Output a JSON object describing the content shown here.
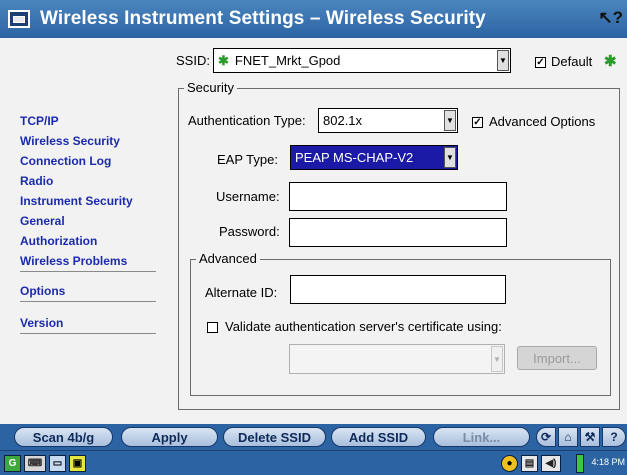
{
  "window": {
    "title": "Wireless Instrument Settings – Wireless Security",
    "help_icon": "help-cursor-icon",
    "help_glyph": "↖?"
  },
  "sidebar": {
    "items": [
      {
        "label": "TCP/IP"
      },
      {
        "label": "Wireless Security",
        "selected": true
      },
      {
        "label": "Connection Log"
      },
      {
        "label": "Radio"
      },
      {
        "label": "Instrument Security"
      },
      {
        "label": "General"
      },
      {
        "label": "Authorization"
      },
      {
        "label": "Wireless Problems"
      },
      {
        "label": "Options"
      },
      {
        "label": "Version"
      }
    ]
  },
  "ssid": {
    "label": "SSID:",
    "value": "FNET_Mrkt_Gpod",
    "icon": "network-star-icon",
    "default_label": "Default",
    "default_checked": true
  },
  "security": {
    "legend": "Security",
    "auth_type_label": "Authentication Type:",
    "auth_type_value": "802.1x",
    "advanced_options_label": "Advanced Options",
    "advanced_options_checked": true,
    "eap_type_label": "EAP Type:",
    "eap_type_value": "PEAP MS-CHAP-V2",
    "username_label": "Username:",
    "username_value": "",
    "password_label": "Password:",
    "password_value": ""
  },
  "advanced": {
    "legend": "Advanced",
    "alternate_id_label": "Alternate ID:",
    "alternate_id_value": "",
    "validate_label": "Validate authentication server's certificate using:",
    "validate_checked": false,
    "certificate_value": "",
    "import_label": "Import..."
  },
  "toolbar": {
    "scan_label": "Scan 4b/g",
    "apply_label": "Apply",
    "delete_label": "Delete SSID",
    "add_label": "Add SSID",
    "link_label": "Link...",
    "icons": [
      "refresh-icon",
      "home-icon",
      "wrench-icon",
      "help-icon"
    ]
  },
  "taskbar": {
    "clock": "4:18 PM",
    "icons": [
      "start-icon",
      "keyboard-icon",
      "window-icon",
      "app-icon",
      "network-icon",
      "clipboard-icon",
      "speaker-icon",
      "battery-icon"
    ]
  },
  "colors": {
    "title_bar": "#2c64a3",
    "nav_link": "#1b2bab",
    "eap_highlight": "#1a1aa6",
    "default_star": "#2a9a2a",
    "battery": "#3cc83c"
  }
}
